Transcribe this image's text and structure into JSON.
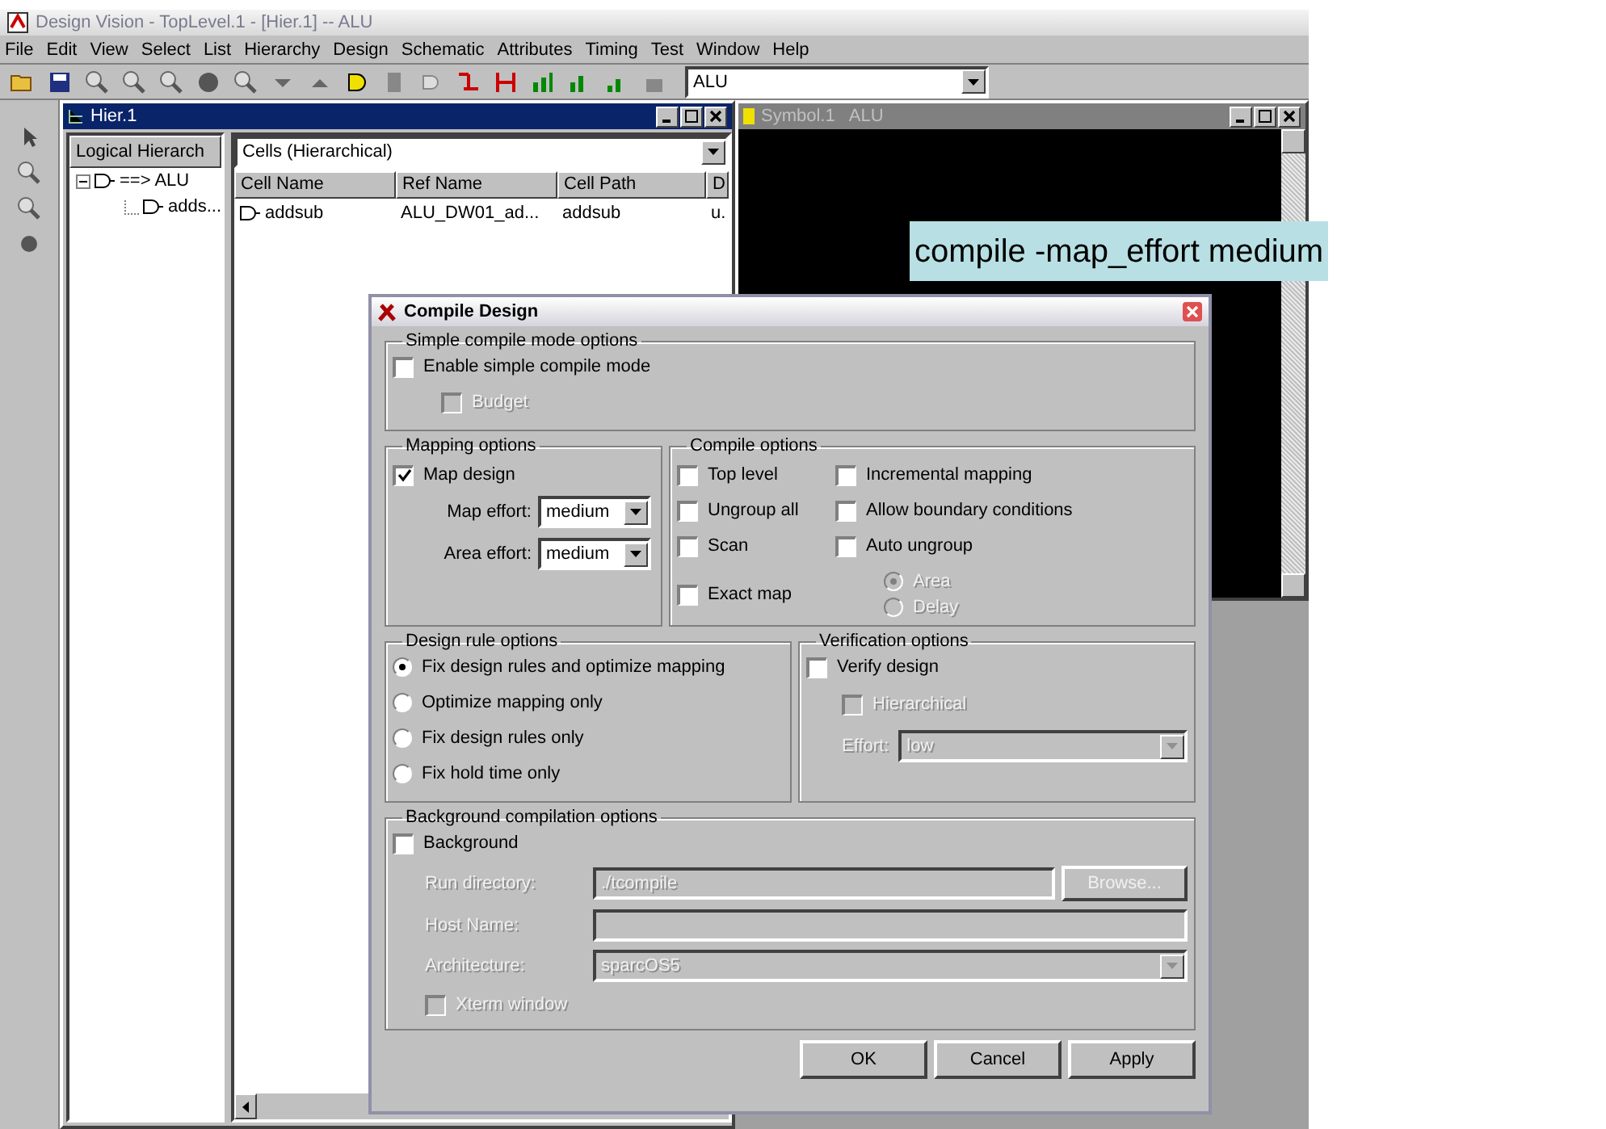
{
  "app": {
    "title": "Design Vision - TopLevel.1 - [Hier.1] -- ALU"
  },
  "menu": [
    "File",
    "Edit",
    "View",
    "Select",
    "List",
    "Hierarchy",
    "Design",
    "Schematic",
    "Attributes",
    "Timing",
    "Test",
    "Window",
    "Help"
  ],
  "toolbar": {
    "design_select": "ALU"
  },
  "hier_window": {
    "title": "Hier.1",
    "active": true,
    "tree_header": "Logical Hierarch",
    "tree": [
      {
        "label": "==> ALU",
        "expanded": true,
        "children": [
          {
            "label": "adds..."
          }
        ]
      }
    ],
    "view_select": "Cells (Hierarchical)",
    "columns": [
      "Cell Name",
      "Ref Name",
      "Cell Path",
      "D"
    ],
    "rows": [
      [
        "addsub",
        "ALU_DW01_ad...",
        "addsub",
        "u."
      ]
    ]
  },
  "symbol_window": {
    "title": "Symbol.1   ALU",
    "active": false
  },
  "annotation": "compile -map_effort medium",
  "dialog": {
    "title": "Compile Design",
    "simple": {
      "legend": "Simple compile mode options",
      "options": [
        {
          "label": "Enable simple compile mode",
          "checked": false,
          "disabled": false
        },
        {
          "label": "Budget",
          "checked": false,
          "disabled": true
        }
      ]
    },
    "mapping": {
      "legend": "Mapping options",
      "map_design": {
        "label": "Map design",
        "checked": true,
        "disabled": false
      },
      "efforts": [
        {
          "label": "Map effort:",
          "value": "medium"
        },
        {
          "label": "Area effort:",
          "value": "medium"
        }
      ]
    },
    "compile": {
      "legend": "Compile options",
      "options": [
        {
          "label": "Top level",
          "checked": false,
          "disabled": false
        },
        {
          "label": "Incremental mapping",
          "checked": false,
          "disabled": false
        },
        {
          "label": "Ungroup all",
          "checked": false,
          "disabled": false
        },
        {
          "label": "Allow boundary conditions",
          "checked": false,
          "disabled": false
        },
        {
          "label": "Scan",
          "checked": false,
          "disabled": false
        },
        {
          "label": "Auto ungroup",
          "checked": false,
          "disabled": false
        }
      ],
      "exact_map": {
        "label": "Exact map",
        "checked": false,
        "disabled": false
      },
      "ungroup_modes": [
        {
          "label": "Area",
          "selected": true,
          "disabled": true
        },
        {
          "label": "Delay",
          "selected": false,
          "disabled": true
        }
      ]
    },
    "design_rules": {
      "legend": "Design rule options",
      "options": [
        {
          "label": "Fix design rules and  optimize mapping",
          "selected": true,
          "disabled": false
        },
        {
          "label": "Optimize mapping only",
          "selected": false,
          "disabled": false
        },
        {
          "label": "Fix design rules only",
          "selected": false,
          "disabled": false
        },
        {
          "label": "Fix hold time only",
          "selected": false,
          "disabled": false
        }
      ]
    },
    "verification": {
      "legend": "Verification options",
      "verify": {
        "label": "Verify design",
        "checked": false,
        "disabled": false
      },
      "hierarchical": {
        "label": "Hierarchical",
        "checked": false,
        "disabled": true
      },
      "effort_label": "Effort:",
      "effort_value": "low",
      "disabled": true
    },
    "background": {
      "legend": "Background compilation options",
      "enable": {
        "label": "Background",
        "checked": false,
        "disabled": false
      },
      "disabled": true,
      "run_dir_label": "Run directory:",
      "run_dir": "./tcompile",
      "browse": "Browse...",
      "host_label": "Host Name:",
      "arch_label": "Architecture:",
      "arch": "sparcOS5",
      "xterm": {
        "label": "Xterm window",
        "checked": false,
        "disabled": true
      }
    },
    "buttons": [
      "OK",
      "Cancel",
      "Apply"
    ]
  }
}
